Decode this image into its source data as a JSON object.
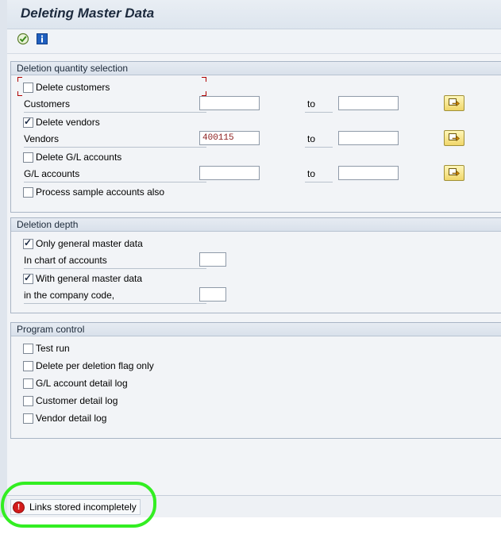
{
  "title": "Deleting Master Data",
  "toolbar": {
    "execute_icon": "execute-icon",
    "info_icon": "info-icon"
  },
  "deletion_quantity": {
    "title": "Deletion quantity selection",
    "delete_customers": {
      "label": "Delete customers",
      "checked": false
    },
    "customers": {
      "label": "Customers",
      "from": "",
      "to_label": "to",
      "to": ""
    },
    "delete_vendors": {
      "label": "Delete vendors",
      "checked": true
    },
    "vendors": {
      "label": "Vendors",
      "from": "400115",
      "to_label": "to",
      "to": ""
    },
    "delete_gl": {
      "label": "Delete G/L accounts",
      "checked": false
    },
    "gl_accounts": {
      "label": "G/L accounts",
      "from": "",
      "to_label": "to",
      "to": ""
    },
    "process_sample": {
      "label": "Process sample accounts also",
      "checked": false
    }
  },
  "deletion_depth": {
    "title": "Deletion depth",
    "only_general": {
      "label": "Only general master data",
      "checked": true
    },
    "chart_of_accounts": {
      "label": "In chart of accounts",
      "value": ""
    },
    "with_general": {
      "label": "With general master data",
      "checked": true
    },
    "company_code": {
      "label": "in the company code,",
      "value": ""
    }
  },
  "program_control": {
    "title": "Program control",
    "test_run": {
      "label": "Test run",
      "checked": false
    },
    "delete_flag": {
      "label": "Delete per deletion flag only",
      "checked": false
    },
    "gl_log": {
      "label": "G/L account detail log",
      "checked": false
    },
    "customer_log": {
      "label": "Customer detail log",
      "checked": false
    },
    "vendor_log": {
      "label": "Vendor detail log",
      "checked": false
    }
  },
  "status": {
    "message": "Links stored incompletely",
    "type": "error"
  },
  "colors": {
    "highlight": "#33ee22",
    "error": "#d31b1b"
  }
}
